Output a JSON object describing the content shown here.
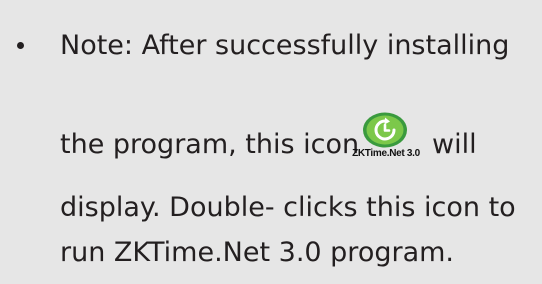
{
  "note": {
    "label": "Note:",
    "line1_rest": " After successfully installing",
    "line2_before_icon": "the program, this icon",
    "line2_after_icon": "will",
    "line3": "display. Double- clicks this icon to",
    "line4": "run ZKTime.Net 3.0 program."
  },
  "app_icon": {
    "icon_name": "clock-refresh-icon",
    "caption": "ZKTime.Net 3.0",
    "colors": {
      "outer": "#3a9a3e",
      "inner": "#7cc84a",
      "glyph": "#ffffff"
    }
  },
  "colors": {
    "background": "#e6e6e6",
    "text": "#231f20"
  }
}
